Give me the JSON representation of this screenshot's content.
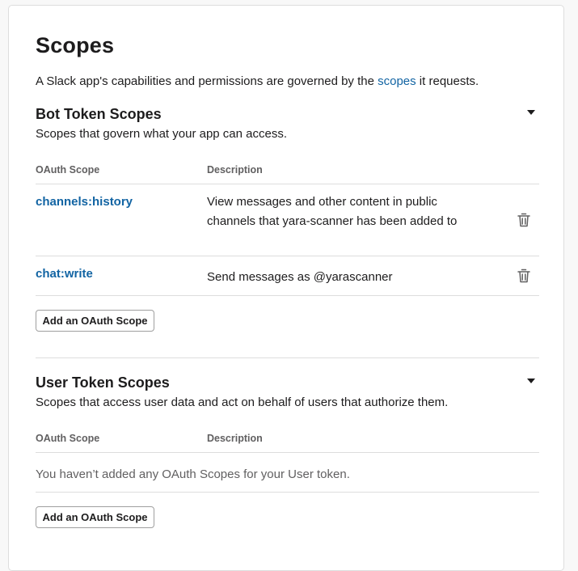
{
  "page": {
    "title": "Scopes",
    "intro_prefix": "A Slack app's capabilities and permissions are governed by the ",
    "intro_link": "scopes",
    "intro_suffix": " it requests."
  },
  "bot": {
    "title": "Bot Token Scopes",
    "subtitle": "Scopes that govern what your app can access.",
    "col_scope": "OAuth Scope",
    "col_desc": "Description",
    "rows": [
      {
        "scope": "channels:history",
        "description": "View messages and other content in public channels that yara-scanner has been added to"
      },
      {
        "scope": "chat:write",
        "description": "Send messages as @yarascanner"
      }
    ],
    "add_button": "Add an OAuth Scope"
  },
  "user": {
    "title": "User Token Scopes",
    "subtitle": "Scopes that access user data and act on behalf of users that authorize them.",
    "col_scope": "OAuth Scope",
    "col_desc": "Description",
    "empty_text": "You haven’t added any OAuth Scopes for your User token.",
    "add_button": "Add an OAuth Scope"
  },
  "icons": {
    "collapse": "caret-down-icon",
    "remove": "trash-icon"
  }
}
